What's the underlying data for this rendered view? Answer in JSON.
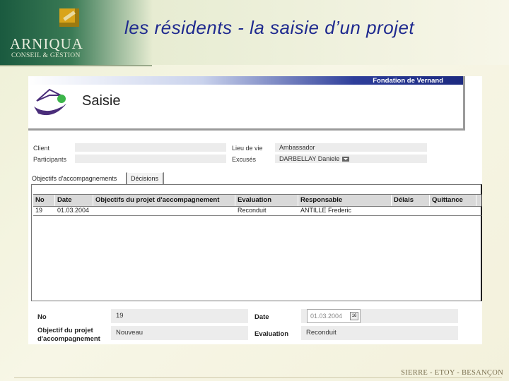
{
  "slide": {
    "title": "les résidents -  la saisie d’un projet",
    "logo_name": "ARNIQUA",
    "logo_sub": "CONSEIL & GESTION",
    "footer": "SIERRE - ETOY - BESANÇON"
  },
  "app": {
    "brand": "Fondation de Vernand",
    "title": "Saisie"
  },
  "form": {
    "client_label": "Client",
    "client_value": "",
    "participants_label": "Participants",
    "participants_value": "",
    "lieu_label": "Lieu de vie",
    "lieu_value": "Ambassador",
    "excuses_label": "Excusés",
    "excuses_value": "DARBELLAY Daniele"
  },
  "tabs": [
    {
      "label": "Objectifs d'accompagnements",
      "active": true
    },
    {
      "label": "Décisions",
      "active": false
    }
  ],
  "table": {
    "columns": [
      "No",
      "Date",
      "Objectifs du projet d'accompagnement",
      "Evaluation",
      "Responsable",
      "Délais",
      "Quittance"
    ],
    "rows": [
      [
        "19",
        "01.03.2004",
        "",
        "Reconduit",
        "ANTILLE Frederic",
        "",
        ""
      ]
    ]
  },
  "detail": {
    "no_label": "No",
    "no_value": "19",
    "date_label": "Date",
    "date_value": "01.03.2004",
    "calendar_icon_text": "16",
    "objectif_label": "Objectif du projet d'accompagnement",
    "objectif_value": "Nouveau",
    "evaluation_label": "Evaluation",
    "evaluation_value": "Reconduit"
  },
  "icons": {
    "brand_logo": "arniqua-logo-icon",
    "app_logo": "fondation-logo-icon",
    "dropdown": "chevron-down-icon",
    "calendar": "calendar-icon"
  },
  "colors": {
    "title": "#1f2a8f",
    "brand_bar": "#1c2a80",
    "logo_gold": "#d9a41a",
    "logo_green": "#1a5a3f",
    "app_logo_green": "#3cb54a",
    "app_logo_purple": "#4a2d7a"
  }
}
